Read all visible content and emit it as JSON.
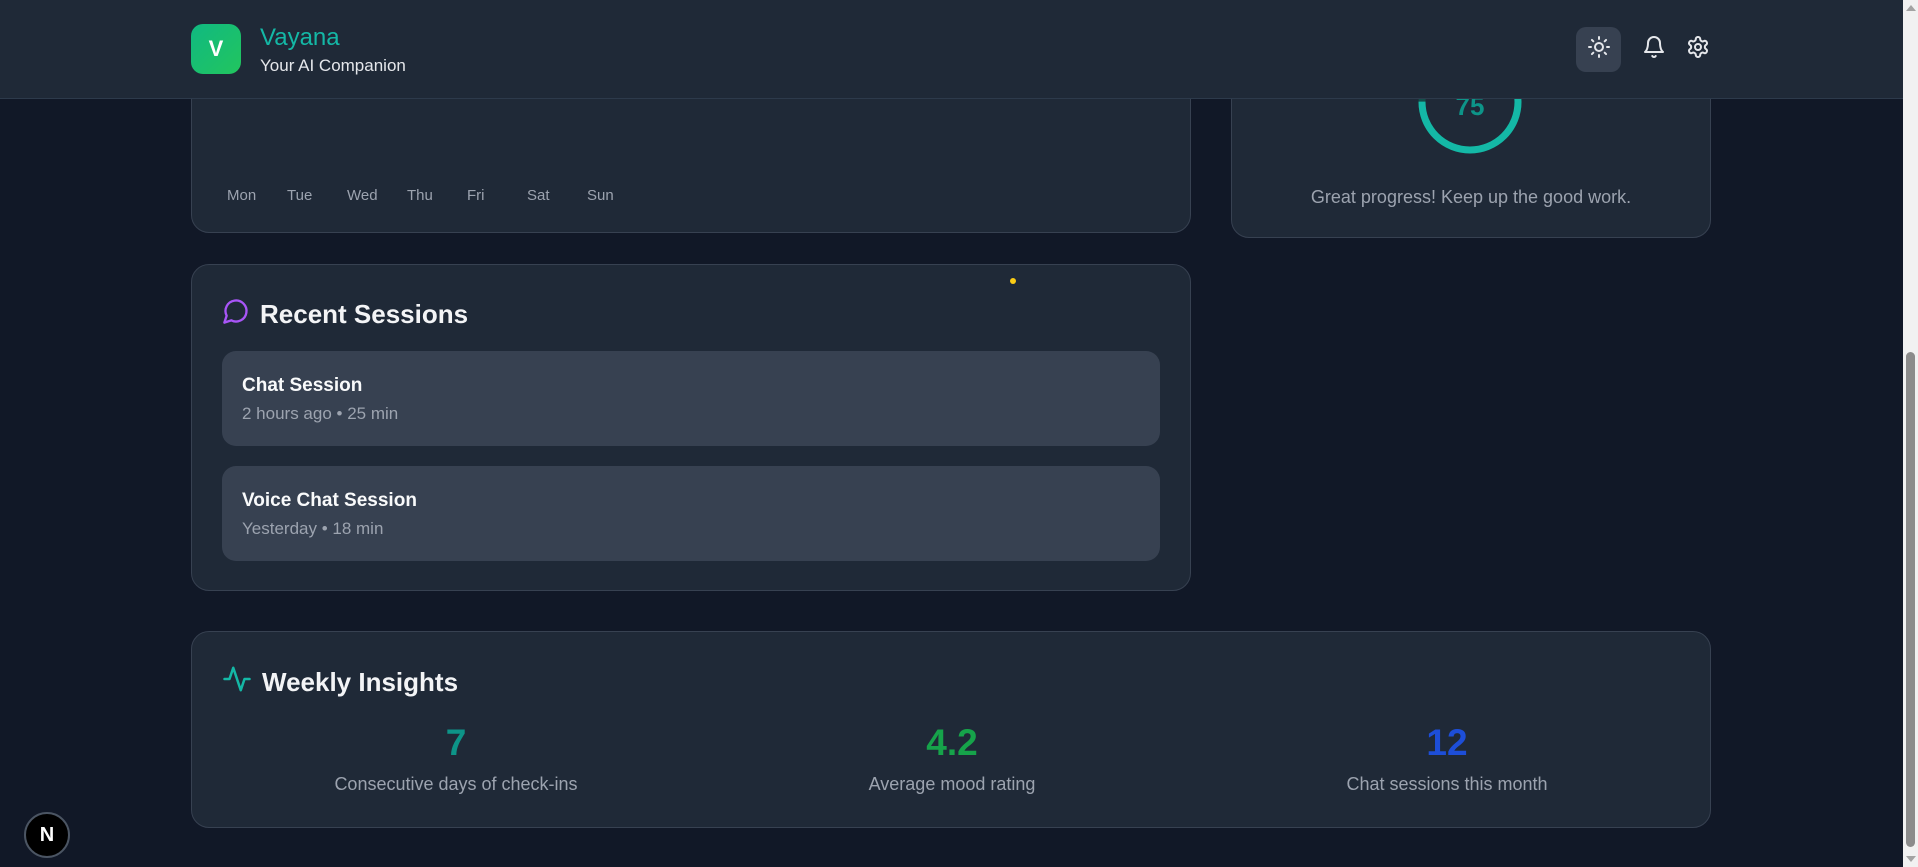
{
  "header": {
    "logo_letter": "V",
    "app_name": "Vayana",
    "tagline": "Your AI Companion",
    "icons": {
      "theme": "sun-icon",
      "notifications": "bell-icon",
      "settings": "gear-icon"
    }
  },
  "mood_chart": {
    "days": [
      "Mon",
      "Tue",
      "Wed",
      "Thu",
      "Fri",
      "Sat",
      "Sun"
    ]
  },
  "progress": {
    "value": "75",
    "value_fraction": 0.75,
    "message": "Great progress! Keep up the good work."
  },
  "recent_sessions": {
    "title": "Recent Sessions",
    "icon": "chat-bubble-icon",
    "items": [
      {
        "name": "Chat Session",
        "meta": "2 hours ago • 25 min"
      },
      {
        "name": "Voice Chat Session",
        "meta": "Yesterday • 18 min"
      }
    ]
  },
  "weekly_insights": {
    "title": "Weekly Insights",
    "icon": "activity-icon",
    "stats": [
      {
        "value": "7",
        "label": "Consecutive days of check-ins",
        "color": "#0d9488"
      },
      {
        "value": "4.2",
        "label": "Average mood rating",
        "color": "#16a34a"
      },
      {
        "value": "12",
        "label": "Chat sessions this month",
        "color": "#1d4ed8"
      }
    ]
  },
  "floating": {
    "next_badge": "N"
  },
  "colors": {
    "background": "#111827",
    "card": "#1f2937",
    "accent_teal": "#14b8a6",
    "session_icon": "#a855f7"
  }
}
